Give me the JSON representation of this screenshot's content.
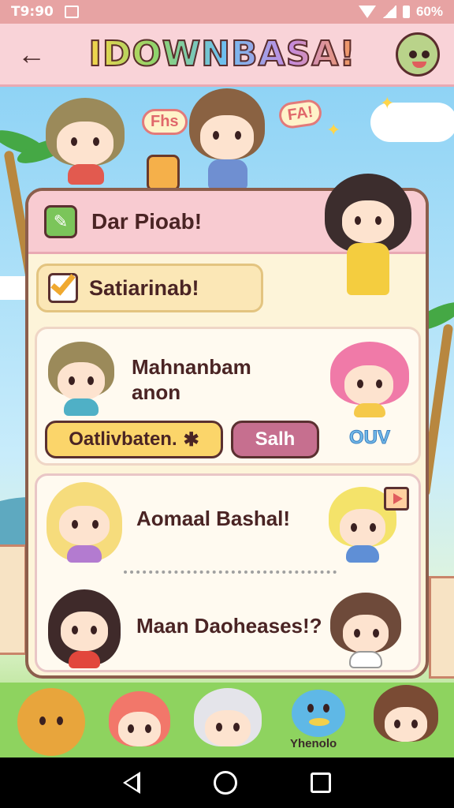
{
  "status_bar": {
    "time": "T9:90",
    "battery": "60%"
  },
  "app_bar": {
    "title": "IDOWNBASA!"
  },
  "bubbles": {
    "left": "Fhs",
    "right": "FA!"
  },
  "panel": {
    "header_title": "Dar Pioab!",
    "checkbox_label": "Satiarinab!",
    "checkbox_checked": true,
    "card1": {
      "text_line1": "Mahnanbam",
      "text_line2": "anon",
      "primary_button": "Oatlivbaten.",
      "primary_button_icon": "✱",
      "secondary_button": "Salh",
      "badge_text": "OUV"
    },
    "card2": {
      "row1_text": "Aomaal Bashal!",
      "row2_text": "Maan Daoheases!?"
    }
  },
  "mascot_label": "Yhenolo",
  "colors": {
    "header_pink": "#f8cbd1",
    "panel_cream": "#fdf4d9",
    "accent_yellow": "#fbd56a",
    "accent_mauve": "#c66f8f"
  }
}
